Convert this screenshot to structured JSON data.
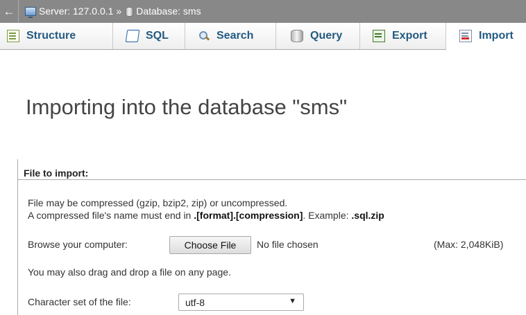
{
  "breadcrumb": {
    "back": "←",
    "server": "Server: 127.0.0.1",
    "separator": "»",
    "database": "Database: sms"
  },
  "tabs": [
    {
      "label": "Structure",
      "icon": "structure-icon"
    },
    {
      "label": "SQL",
      "icon": "sql-icon"
    },
    {
      "label": "Search",
      "icon": "search-icon"
    },
    {
      "label": "Query",
      "icon": "query-icon"
    },
    {
      "label": "Export",
      "icon": "export-icon"
    },
    {
      "label": "Import",
      "icon": "import-icon",
      "active": true
    }
  ],
  "main": {
    "title": "Importing into the database \"sms\"",
    "section_legend": "File to import:",
    "compress_note_line1": "File may be compressed (gzip, bzip2, zip) or uncompressed.",
    "compress_note_line2_pre": "A compressed file's name must end in ",
    "compress_note_line2_format": ".[format].[compression]",
    "compress_note_line2_mid": ". Example: ",
    "compress_note_line2_example": ".sql.zip",
    "browse_label": "Browse your computer:",
    "choose_file_button": "Choose File",
    "no_file_text": "No file chosen",
    "max_size": "(Max: 2,048KiB)",
    "drag_drop_note": "You may also drag and drop a file on any page.",
    "charset_label": "Character set of the file:",
    "charset_value": "utf-8",
    "charset_caret": "▼"
  },
  "colors": {
    "topbar": "#888888",
    "tab_text": "#235a81",
    "title": "#444444"
  }
}
